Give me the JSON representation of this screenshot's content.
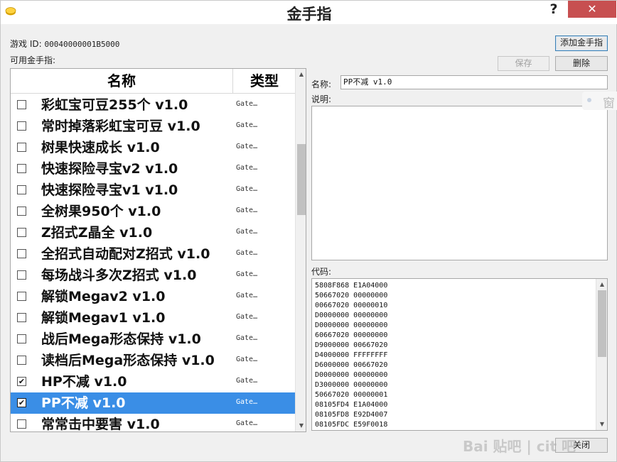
{
  "window": {
    "title": "金手指",
    "help": "?",
    "close": "✕"
  },
  "game": {
    "id_label": "游戏 ID:",
    "id_value": "00040000001B5000"
  },
  "list_label": "可用金手指:",
  "buttons": {
    "add": "添加金手指",
    "save": "保存",
    "delete": "删除",
    "close": "关闭"
  },
  "list": {
    "header_name": "名称",
    "header_type": "类型",
    "rows": [
      {
        "name": "彩虹宝可豆255个 v1.0",
        "type": "Gate…",
        "checked": false,
        "selected": false
      },
      {
        "name": "常时掉落彩虹宝可豆 v1.0",
        "type": "Gate…",
        "checked": false,
        "selected": false
      },
      {
        "name": "树果快速成长 v1.0",
        "type": "Gate…",
        "checked": false,
        "selected": false
      },
      {
        "name": "快速探险寻宝v2 v1.0",
        "type": "Gate…",
        "checked": false,
        "selected": false
      },
      {
        "name": "快速探险寻宝v1 v1.0",
        "type": "Gate…",
        "checked": false,
        "selected": false
      },
      {
        "name": "全树果950个 v1.0",
        "type": "Gate…",
        "checked": false,
        "selected": false
      },
      {
        "name": "Z招式Z晶全 v1.0",
        "type": "Gate…",
        "checked": false,
        "selected": false
      },
      {
        "name": "全招式自动配对Z招式 v1.0",
        "type": "Gate…",
        "checked": false,
        "selected": false
      },
      {
        "name": "每场战斗多次Z招式 v1.0",
        "type": "Gate…",
        "checked": false,
        "selected": false
      },
      {
        "name": "解锁Megav2 v1.0",
        "type": "Gate…",
        "checked": false,
        "selected": false
      },
      {
        "name": "解锁Megav1 v1.0",
        "type": "Gate…",
        "checked": false,
        "selected": false
      },
      {
        "name": "战后Mega形态保持 v1.0",
        "type": "Gate…",
        "checked": false,
        "selected": false
      },
      {
        "name": "读档后Mega形态保持 v1.0",
        "type": "Gate…",
        "checked": false,
        "selected": false
      },
      {
        "name": "HP不减 v1.0",
        "type": "Gate…",
        "checked": true,
        "selected": false
      },
      {
        "name": "PP不减 v1.0",
        "type": "Gate…",
        "checked": true,
        "selected": true
      },
      {
        "name": "常常击中要害 v1.0",
        "type": "Gate…",
        "checked": false,
        "selected": false
      }
    ]
  },
  "detail": {
    "name_label": "名称:",
    "name_value": "PP不减 v1.0",
    "desc_label": "说明:",
    "code_label": "代码:",
    "code_lines": [
      "5808F868 E1A04000",
      "50667020 00000000",
      "00667020 00000010",
      "D0000000 00000000",
      "D0000000 00000000",
      "60667020 00000000",
      "D9000000 00667020",
      "D4000000 FFFFFFFF",
      "D6000000 00667020",
      "D0000000 00000000",
      "D3000000 00000000",
      "50667020 00000001",
      "08105FD4 E1A04000",
      "08105FD8 E92D4007",
      "08105FDC E59F0018"
    ]
  },
  "overlay_text": "窗",
  "watermark": "Bai 贴吧 | cit 吧"
}
